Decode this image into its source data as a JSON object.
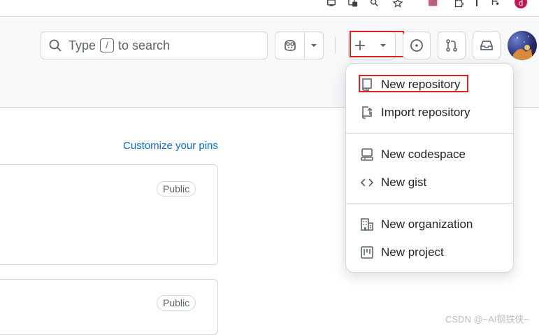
{
  "search": {
    "prefix": "Type",
    "key": "/",
    "suffix": "to search"
  },
  "header": {
    "avatar_letter": "d"
  },
  "main": {
    "customize_link": "Customize your pins",
    "cards": [
      {
        "badge": "Public"
      },
      {
        "badge": "Public"
      }
    ]
  },
  "create_menu": {
    "items": [
      {
        "label": "New repository",
        "icon": "repo-icon"
      },
      {
        "label": "Import repository",
        "icon": "repo-push-icon"
      },
      {
        "label": "New codespace",
        "icon": "codespaces-icon"
      },
      {
        "label": "New gist",
        "icon": "code-icon"
      },
      {
        "label": "New organization",
        "icon": "organization-icon"
      },
      {
        "label": "New project",
        "icon": "project-icon"
      }
    ]
  },
  "watermark": "CSDN @~AI钢铁侠~",
  "colors": {
    "highlight": "#e02020",
    "link": "#0969da",
    "border": "#d0d7de"
  }
}
